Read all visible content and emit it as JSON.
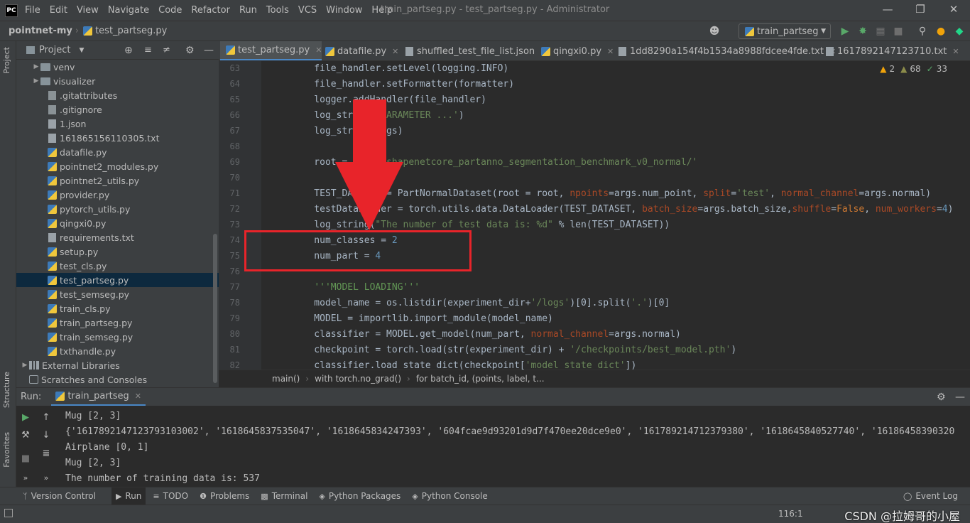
{
  "window": {
    "logo": "PC",
    "title": "train_partseg.py - test_partseg.py - Administrator",
    "menu": [
      "File",
      "Edit",
      "View",
      "Navigate",
      "Code",
      "Refactor",
      "Run",
      "Tools",
      "VCS",
      "Window",
      "Help"
    ]
  },
  "nav": {
    "project": "pointnet-my",
    "file": "test_partseg.py",
    "run_config": "train_partseg"
  },
  "project_panel": {
    "title": "Project",
    "items": [
      {
        "label": "venv",
        "type": "folder"
      },
      {
        "label": "visualizer",
        "type": "folder"
      },
      {
        "label": ".gitattributes",
        "type": "git"
      },
      {
        "label": ".gitignore",
        "type": "git"
      },
      {
        "label": "1.json",
        "type": "json"
      },
      {
        "label": "161865156110305.txt",
        "type": "txt"
      },
      {
        "label": "datafile.py",
        "type": "py"
      },
      {
        "label": "pointnet2_modules.py",
        "type": "py"
      },
      {
        "label": "pointnet2_utils.py",
        "type": "py"
      },
      {
        "label": "provider.py",
        "type": "py"
      },
      {
        "label": "pytorch_utils.py",
        "type": "py"
      },
      {
        "label": "qingxi0.py",
        "type": "py"
      },
      {
        "label": "requirements.txt",
        "type": "txt"
      },
      {
        "label": "setup.py",
        "type": "py"
      },
      {
        "label": "test_cls.py",
        "type": "py"
      },
      {
        "label": "test_partseg.py",
        "type": "py",
        "selected": true
      },
      {
        "label": "test_semseg.py",
        "type": "py"
      },
      {
        "label": "train_cls.py",
        "type": "py"
      },
      {
        "label": "train_partseg.py",
        "type": "py"
      },
      {
        "label": "train_semseg.py",
        "type": "py"
      },
      {
        "label": "txthandle.py",
        "type": "py"
      },
      {
        "label": "External Libraries",
        "type": "lib"
      },
      {
        "label": "Scratches and Consoles",
        "type": "scratch"
      }
    ]
  },
  "side_labels": {
    "project": "Project",
    "structure": "Structure",
    "favorites": "Favorites"
  },
  "editor_tabs": [
    {
      "label": "test_partseg.py",
      "active": true
    },
    {
      "label": "datafile.py"
    },
    {
      "label": "shuffled_test_file_list.json"
    },
    {
      "label": "qingxi0.py"
    },
    {
      "label": "1dd8290a154f4b1534a8988fdcee4fde.txt"
    },
    {
      "label": "1617892147123710.txt"
    }
  ],
  "inspection": {
    "warnings": "2",
    "weak_warnings": "68",
    "typos": "33"
  },
  "code_lines": [
    {
      "n": "63",
      "text": "    file_handler.setLevel(logging.INFO)"
    },
    {
      "n": "64",
      "text": "    file_handler.setFormatter(formatter)"
    },
    {
      "n": "65",
      "text": "    logger.addHandler(file_handler)"
    },
    {
      "n": "66",
      "text": "    log_string('PARAMETER ...')"
    },
    {
      "n": "67",
      "text": "    log_string(args)"
    },
    {
      "n": "68",
      "text": ""
    },
    {
      "n": "69",
      "text": "    root = 'data/shapenetcore_partanno_segmentation_benchmark_v0_normal/'"
    },
    {
      "n": "70",
      "text": ""
    },
    {
      "n": "71",
      "text": "    TEST_DATASET = PartNormalDataset(root = root, npoints=args.num_point, split='test', normal_channel=args.normal)"
    },
    {
      "n": "72",
      "text": "    testDataLoader = torch.utils.data.DataLoader(TEST_DATASET, batch_size=args.batch_size,shuffle=False, num_workers=4)"
    },
    {
      "n": "73",
      "text": "    log_string(\"The number of test data is: %d\" % len(TEST_DATASET))"
    },
    {
      "n": "74",
      "text": "    num_classes = 2"
    },
    {
      "n": "75",
      "text": "    num_part = 4"
    },
    {
      "n": "76",
      "text": ""
    },
    {
      "n": "77",
      "text": "    '''MODEL LOADING'''"
    },
    {
      "n": "78",
      "text": "    model_name = os.listdir(experiment_dir+'/logs')[0].split('.')[0]"
    },
    {
      "n": "79",
      "text": "    MODEL = importlib.import_module(model_name)"
    },
    {
      "n": "80",
      "text": "    classifier = MODEL.get_model(num_part, normal_channel=args.normal)"
    },
    {
      "n": "81",
      "text": "    checkpoint = torch.load(str(experiment_dir) + '/checkpoints/best_model.pth')"
    },
    {
      "n": "82",
      "text": "    classifier.load_state_dict(checkpoint['model_state_dict'])"
    }
  ],
  "breadcrumb": [
    "main()",
    "with torch.no_grad()",
    "for batch_id, (points, label, t..."
  ],
  "run": {
    "label": "Run:",
    "tab": "train_partseg",
    "output": [
      "Mug [2, 3]",
      "{'1617892147123793103002', '1618645837535047', '1618645834247393', '604fcae9d93201d9d7f470ee20dce9e0', '161789214712379380', '1618645840527740', '16186458390320",
      "Airplane [0, 1]",
      "Mug [2, 3]",
      "The number of training data is: 537"
    ]
  },
  "bottom_tools": [
    "Version Control",
    "Run",
    "TODO",
    "Problems",
    "Terminal",
    "Python Packages",
    "Python Console"
  ],
  "event_log": "Event Log",
  "status": {
    "position": "116:1",
    "watermark": "CSDN @拉姆哥的小屋"
  }
}
